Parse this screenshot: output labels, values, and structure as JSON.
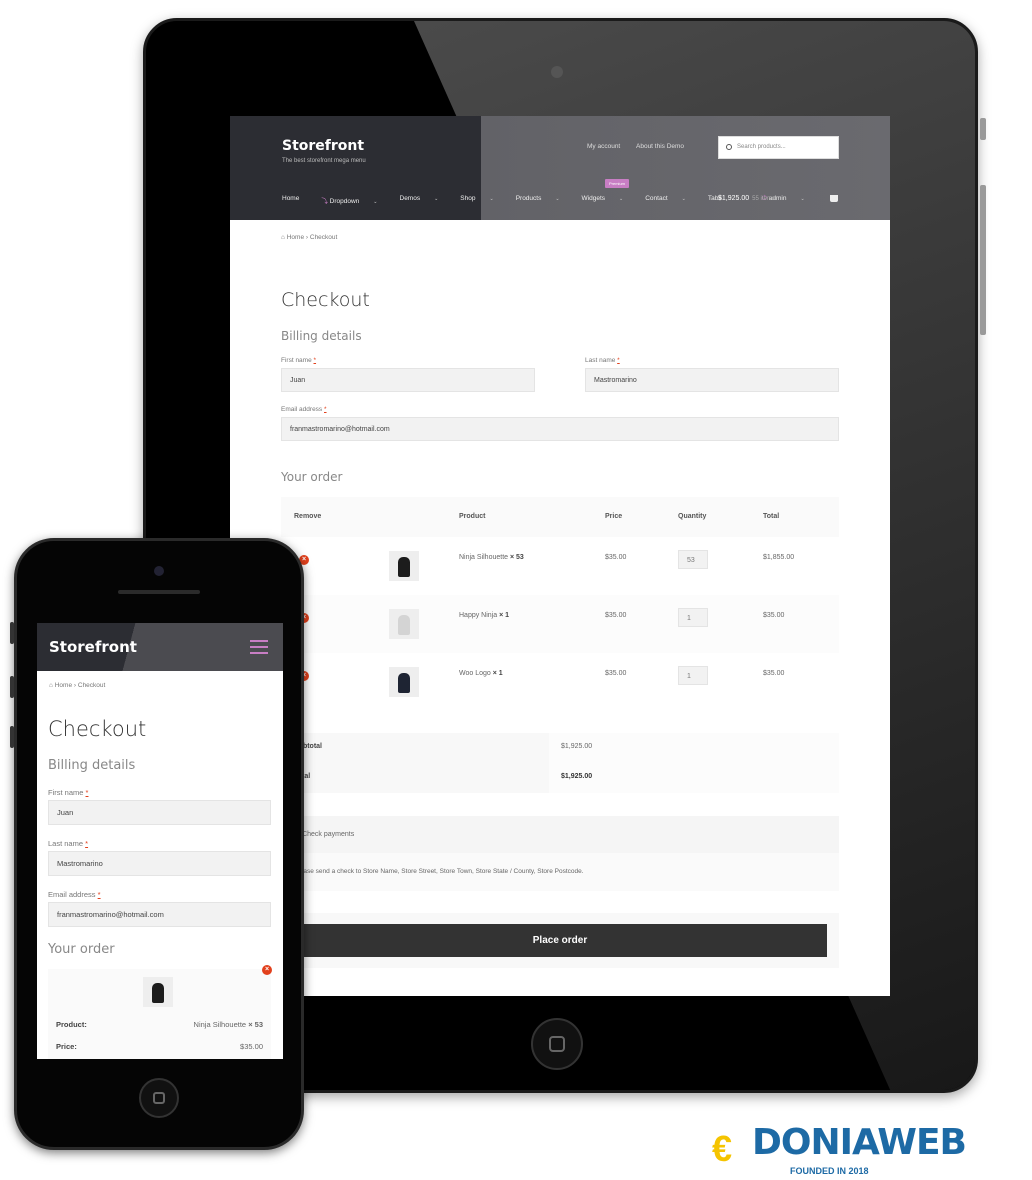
{
  "tablet": {
    "header": {
      "brand": "Storefront",
      "tagline": "The best storefront mega menu",
      "top_links": [
        "My account",
        "About this Demo"
      ],
      "search_placeholder": "Search products...",
      "nav": [
        {
          "label": "Home",
          "has_caret": false
        },
        {
          "label": "Dropdown",
          "has_caret": true
        },
        {
          "label": "Demos",
          "has_caret": true
        },
        {
          "label": "Shop",
          "has_caret": true
        },
        {
          "label": "Products",
          "has_caret": true
        },
        {
          "label": "Widgets",
          "has_caret": true
        },
        {
          "label": "Contact",
          "has_caret": true
        },
        {
          "label": "Tabs",
          "has_caret": true
        },
        {
          "label": "admin",
          "has_caret": true
        }
      ],
      "premium_badge": "Premium",
      "cart_total": "$1,925.00",
      "cart_count": "55 items"
    },
    "breadcrumb": {
      "home": "Home",
      "separator": "›",
      "current": "Checkout"
    },
    "page_title": "Checkout",
    "billing": {
      "heading": "Billing details",
      "first_name_label": "First name",
      "first_name": "Juan",
      "last_name_label": "Last name",
      "last_name": "Mastromarino",
      "email_label": "Email address",
      "email": "franmastromarino@hotmail.com",
      "required_mark": "*"
    },
    "order": {
      "heading": "Your order",
      "columns": [
        "Remove",
        "",
        "Product",
        "Price",
        "Quantity",
        "Total"
      ],
      "items": [
        {
          "name": "Ninja Silhouette",
          "qty_label": "× 53",
          "price": "$35.00",
          "qty": "53",
          "total": "$1,855.00",
          "color": "#1c1c1c"
        },
        {
          "name": "Happy Ninja",
          "qty_label": "× 1",
          "price": "$35.00",
          "qty": "1",
          "total": "$35.00",
          "color": "#d4d4d4"
        },
        {
          "name": "Woo Logo",
          "qty_label": "× 1",
          "price": "$35.00",
          "qty": "1",
          "total": "$35.00",
          "color": "#1e2433"
        }
      ],
      "subtotal_label": "Subtotal",
      "subtotal": "$1,925.00",
      "total_label": "Total",
      "total": "$1,925.00"
    },
    "payment": {
      "method": "Check payments",
      "description": "Please send a check to Store Name, Store Street, Store Town, Store State / County, Store Postcode."
    },
    "place_order": "Place order"
  },
  "phone": {
    "brand": "Storefront",
    "breadcrumb": {
      "home": "Home",
      "separator": "›",
      "current": "Checkout"
    },
    "page_title": "Checkout",
    "billing_heading": "Billing details",
    "first_name_label": "First name",
    "first_name": "Juan",
    "last_name_label": "Last name",
    "last_name": "Mastromarino",
    "email_label": "Email address",
    "email": "franmastromarino@hotmail.com",
    "required_mark": "*",
    "order_heading": "Your order",
    "product_label": "Product:",
    "product_value": "Ninja Silhouette",
    "product_qty": "× 53",
    "price_label": "Price:",
    "price_value": "$35.00"
  },
  "watermark": {
    "text": "DONIAWEB",
    "sub": "FOUNDED IN 2018"
  },
  "colors": {
    "accent": "#c87ec4",
    "remove": "#e2401c",
    "button": "#333333"
  }
}
